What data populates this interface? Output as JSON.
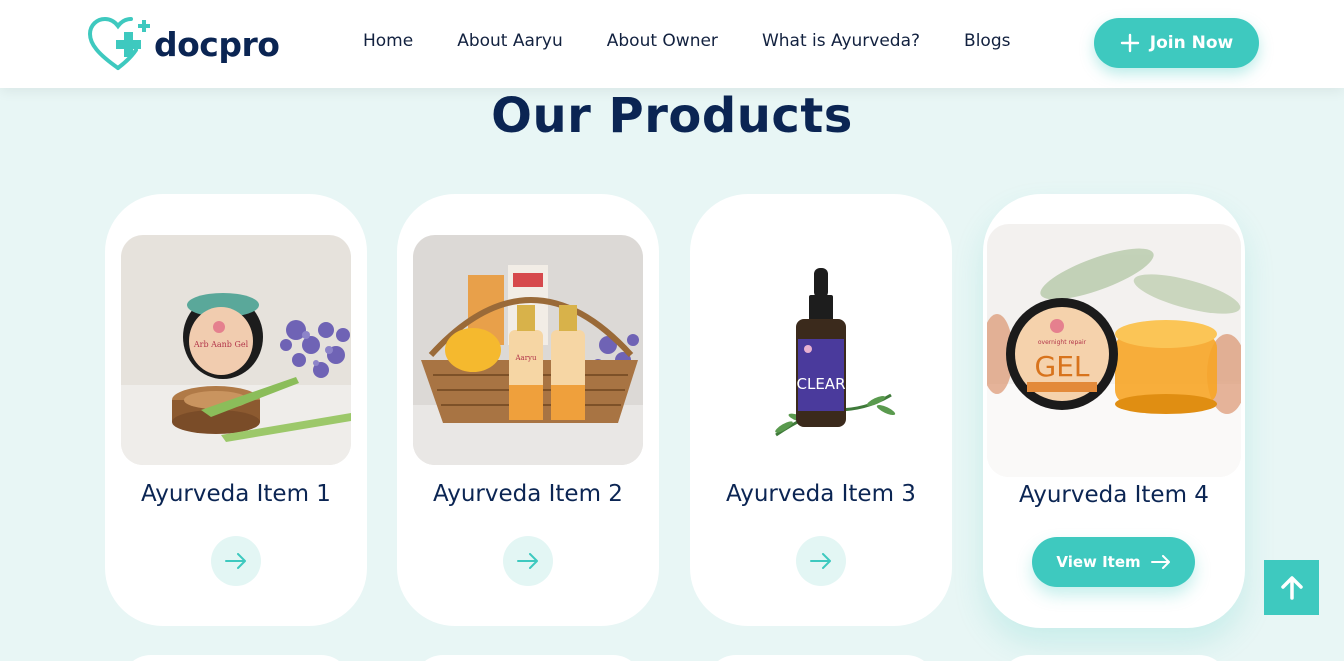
{
  "header": {
    "logo_text": "docpro",
    "nav": [
      "Home",
      "About Aaryu",
      "About Owner",
      "What is Ayurveda?",
      "Blogs"
    ],
    "join_label": "Join Now"
  },
  "section": {
    "title": "Our Products"
  },
  "products": [
    {
      "name": "Ayurveda Item 1",
      "image_label": "Arb Aanb Gel"
    },
    {
      "name": "Ayurveda Item 2",
      "image_label": "Aaryu"
    },
    {
      "name": "Ayurveda Item 3",
      "image_label": "CLEAR"
    },
    {
      "name": "Ayurveda Item 4",
      "image_label": "GEL",
      "image_label_small": "overnight repair",
      "button_label": "View Item"
    }
  ],
  "colors": {
    "accent": "#3ec9bf",
    "navy": "#0b2553",
    "background": "#e8f6f5"
  },
  "icons": {
    "join": "plus-icon",
    "view": "arrow-right-icon",
    "scroll_top": "arrow-up-icon"
  }
}
